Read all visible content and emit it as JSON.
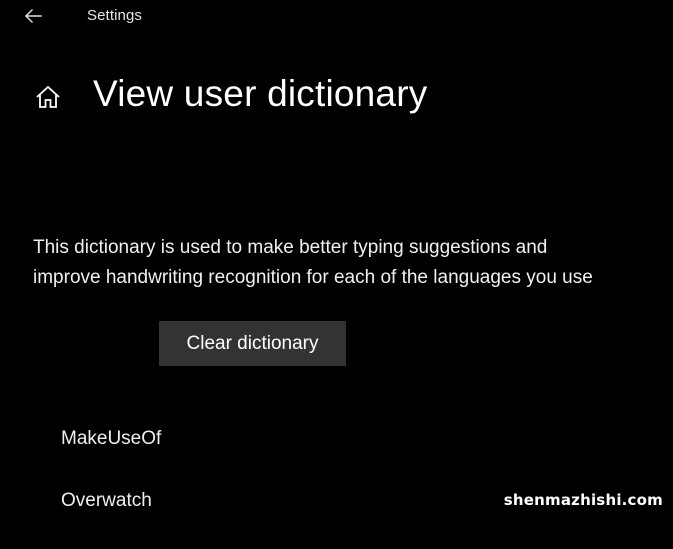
{
  "window": {
    "app_title": "Settings",
    "back_icon": "arrow-left-icon"
  },
  "header": {
    "home_icon": "home-icon",
    "title": "View user dictionary"
  },
  "description": {
    "line1": "This dictionary is used to make better typing suggestions and",
    "line2": "improve handwriting recognition for each of the languages you use"
  },
  "actions": {
    "clear_label": "Clear dictionary"
  },
  "dictionary": {
    "words": [
      "MakeUseOf",
      "Overwatch"
    ]
  },
  "watermark": {
    "text": "shenmazhishi.com"
  },
  "colors": {
    "background": "#000000",
    "text": "#ffffff",
    "button_bg": "#333333"
  }
}
